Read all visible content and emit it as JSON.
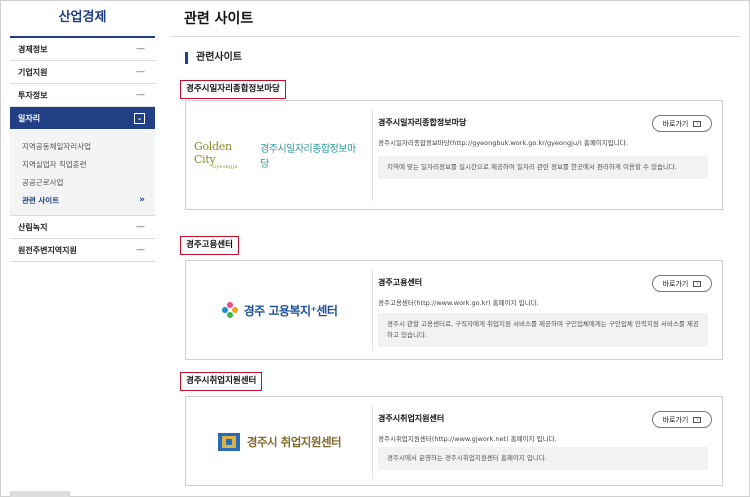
{
  "sidebar": {
    "title": "산업경제",
    "items": [
      {
        "label": "경제정보",
        "toggle": "—"
      },
      {
        "label": "기업지원",
        "toggle": "—"
      },
      {
        "label": "투자정보",
        "toggle": "—"
      }
    ],
    "active": {
      "label": "일자리",
      "toggle": "⌄"
    },
    "sub_items": [
      {
        "label": "지역공동체일자리사업"
      },
      {
        "label": "지역실업자 직업훈련"
      },
      {
        "label": "공공근로사업"
      },
      {
        "label": "관련 사이트",
        "arrow": "»"
      }
    ],
    "items_after": [
      {
        "label": "산림녹지",
        "toggle": "—"
      },
      {
        "label": "원전주변지역지원",
        "toggle": "—"
      }
    ]
  },
  "main": {
    "page_title": "관련 사이트",
    "section_heading": "관련사이트",
    "button_label": "바로가기",
    "groups": [
      {
        "label": "경주시일자리종합정보마당",
        "name": "경주시일자리종합정보마당",
        "desc": "경주시일자리종합정보마당(http://gyeongbuk.work.go.kr/gyeongju/) 홈페이지입니다.",
        "note": "지역에 맞는 일자리정보를 실시간으로 제공하여 일자리 관련 정보를 한곳에서 편리하게 이용할 수 있습니다.",
        "logo_text_en": "Golden City",
        "logo_text_en_sub": "Gyeongju",
        "logo_text_kr": "경주시일자리종합정보마당"
      },
      {
        "label": "경주고용센터",
        "name": "경주고용센터",
        "desc": "경주고용센터(http://www.work.go.kr) 홈페이지 입니다.",
        "note": "경주시 관할 고용센터로, 구직자에게 취업지원 서비스를 제공하며 구인업체에게는 구인업체 인력지원 서비스를 제공하고 있습니다.",
        "logo_text": "경주 고용복지⁺센터"
      },
      {
        "label": "경주시취업지원센터",
        "name": "경주시취업지원센터",
        "desc": "경주시취업지원센터(http://www.gjwork.net) 홈페이지 입니다.",
        "note": "경주시에서 운영하는 경주시취업지원센터 홈페이지 입니다.",
        "logo_text": "경주시 취업지원센터"
      }
    ]
  }
}
